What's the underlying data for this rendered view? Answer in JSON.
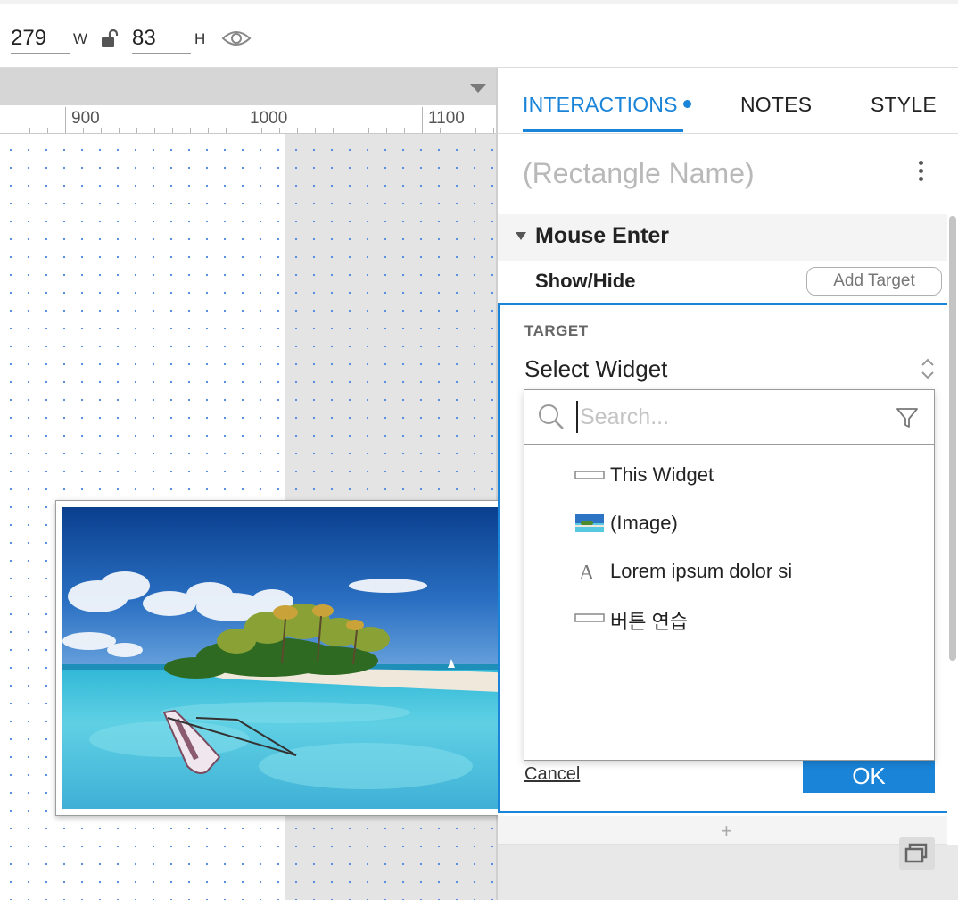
{
  "toolbar": {
    "width_value": "279",
    "width_label": "W",
    "height_value": "83",
    "height_label": "H"
  },
  "ruler": {
    "labels": [
      "900",
      "1000",
      "1100"
    ]
  },
  "panel": {
    "tabs": [
      {
        "label": "INTERACTIONS",
        "active": true
      },
      {
        "label": "NOTES",
        "active": false
      },
      {
        "label": "STYLE",
        "active": false
      }
    ],
    "widget_name_placeholder": "(Rectangle Name)",
    "event_label": "Mouse Enter",
    "action_label": "Show/Hide",
    "add_target_label": "Add Target",
    "target_heading": "TARGET",
    "select_widget_label": "Select Widget",
    "cancel_label": "Cancel",
    "ok_label": "OK",
    "add_icon": "+"
  },
  "dropdown": {
    "search_placeholder": "Search...",
    "items": [
      {
        "label": "This Widget",
        "icon": "rectangle-widget-icon"
      },
      {
        "label": "(Image)",
        "icon": "image-thumbnail-icon"
      },
      {
        "label": "Lorem ipsum dolor si",
        "icon": "text-widget-icon"
      },
      {
        "label": "버튼 연습",
        "icon": "rectangle-widget-icon"
      }
    ]
  },
  "colors": {
    "accent": "#1a84d8",
    "grid_dot": "#5b8fe0"
  }
}
